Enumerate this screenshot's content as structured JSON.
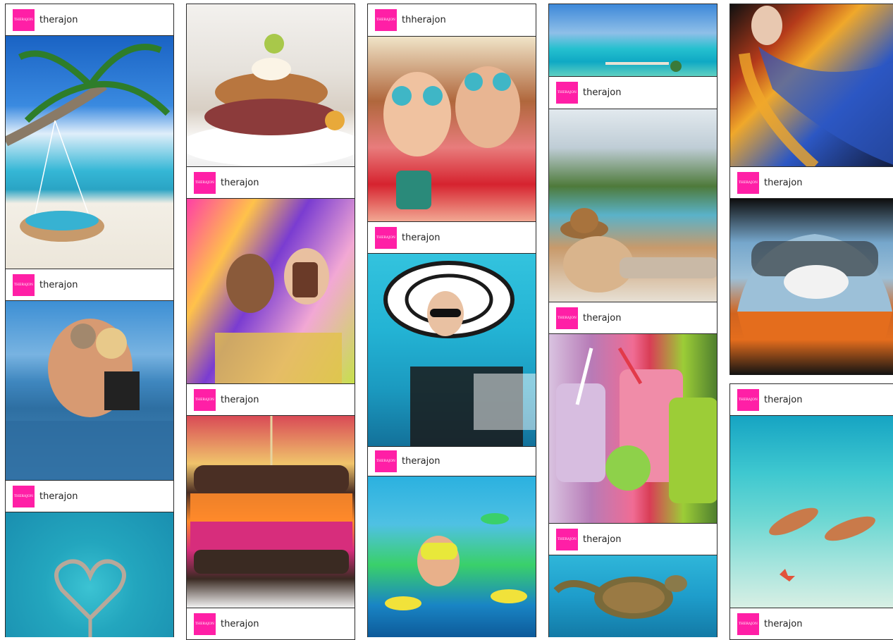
{
  "brand": {
    "logo_text": "THERAJON",
    "accent_color": "#ff1fa6"
  },
  "columns": [
    {
      "items": [
        {
          "kind": "tag",
          "name": "therajon"
        },
        {
          "kind": "image",
          "subject": "beach-swing-palm"
        },
        {
          "kind": "tag",
          "name": "therajon"
        },
        {
          "kind": "image",
          "subject": "couple-infinity-pool"
        },
        {
          "kind": "tag",
          "name": "therajon"
        },
        {
          "kind": "image",
          "subject": "heart-island-aerial"
        }
      ]
    },
    {
      "items": [
        {
          "kind": "image",
          "subject": "crab-cake-plate"
        },
        {
          "kind": "tag",
          "name": "therajon"
        },
        {
          "kind": "image",
          "subject": "carnival-women"
        },
        {
          "kind": "tag",
          "name": "therajon"
        },
        {
          "kind": "image",
          "subject": "veggie-sandwich"
        },
        {
          "kind": "tag",
          "name": "therajon"
        }
      ]
    },
    {
      "items": [
        {
          "kind": "tag",
          "name": "thherajon"
        },
        {
          "kind": "image",
          "subject": "girls-sunglasses"
        },
        {
          "kind": "tag",
          "name": "therajon"
        },
        {
          "kind": "image",
          "subject": "woman-sun-hat"
        },
        {
          "kind": "tag",
          "name": "therajon"
        },
        {
          "kind": "image",
          "subject": "snorkeler-fish"
        }
      ]
    },
    {
      "items": [
        {
          "kind": "image",
          "subject": "turquoise-sea-dock"
        },
        {
          "kind": "tag",
          "name": "therajon"
        },
        {
          "kind": "image",
          "subject": "woman-pool-lounge"
        },
        {
          "kind": "tag",
          "name": "therajon"
        },
        {
          "kind": "image",
          "subject": "fruit-smoothies"
        },
        {
          "kind": "tag",
          "name": "therajon"
        },
        {
          "kind": "image",
          "subject": "sea-turtle"
        }
      ]
    },
    {
      "items": [
        {
          "kind": "image",
          "subject": "feather-fashion"
        },
        {
          "kind": "tag",
          "name": "therajon"
        },
        {
          "kind": "image",
          "subject": "race-car-70"
        },
        {
          "kind": "tag",
          "name": "therajon"
        },
        {
          "kind": "image",
          "subject": "snorkelers-shallows"
        },
        {
          "kind": "tag",
          "name": "therajon"
        }
      ]
    }
  ]
}
